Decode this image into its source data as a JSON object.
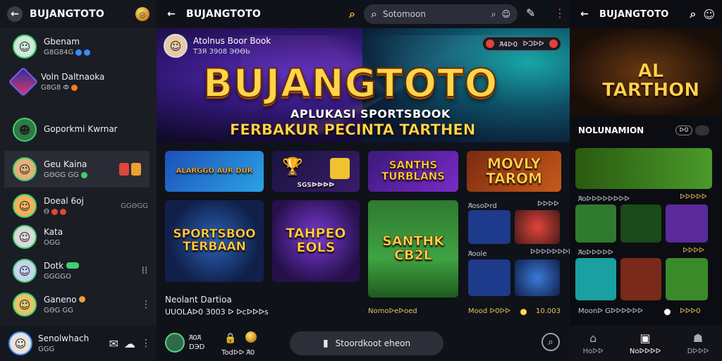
{
  "left_panel": {
    "header_title": "BUJANGTOTO",
    "chats": [
      {
        "name": "Gbenam",
        "sub": "G8G84G",
        "right": ""
      },
      {
        "name": "Voln Daltnaoka",
        "sub": "G8G8 Ф",
        "right": ""
      },
      {
        "name": "Goporkmi Kwrnar",
        "sub": "",
        "right": ""
      },
      {
        "name": "Geu Kaina",
        "sub": "GΘGG GG",
        "right": ""
      },
      {
        "name": "Doeal 6oj",
        "sub": "Ө",
        "right": "GGΘGG"
      },
      {
        "name": "Kata",
        "sub": "OGG",
        "right": ""
      },
      {
        "name": "Dotk",
        "sub": "GGGGO",
        "right": ""
      },
      {
        "name": "Ganeno",
        "sub": "GΘG GG",
        "right": ""
      },
      {
        "name": "Senolwhach",
        "sub": "GGG",
        "right": ""
      }
    ]
  },
  "banner": {
    "logo": "BUJANGTOTO",
    "tagline1": "APLUKASI SPORTSBOOK",
    "tagline2": "FERBAKUR PECINTA TARTHEN",
    "account_name": "Atolnus Boor Book",
    "account_sub": "ТЗЯ 3908 ЭӨӨЬ",
    "pill_left": "Ꞻ4ᐅ0",
    "pill_right": "ᐅƆᐅᐅ"
  },
  "middle": {
    "header_title": "BUJANGTOTO",
    "tiles": [
      {
        "label": "ALARGGO AUR DUR",
        "sub": "ᐅᐅᐅᐅ"
      },
      {
        "label": "",
        "sub": "SGSᐅᐅᐅᐅ"
      },
      {
        "label": "SPORTSBOO TERBAAN",
        "sub": ""
      },
      {
        "label": "TAHPEO EOLS",
        "sub": ""
      }
    ],
    "caption_title": "Neolant Dartioa",
    "caption_sub": "UUOLAᐅ0 3003 ᐅ ᐅcᐅᐅᐅs",
    "bottom_nav": {
      "mini_top": "Ꞻ0Ꞻ",
      "mini_bottom": "DЭD",
      "label": "Todᐅᐅ Ꞻ0"
    }
  },
  "search": {
    "placeholder": "Sotomoon",
    "button_label": "Stoordkoot eheon"
  },
  "games": {
    "tiles": [
      {
        "label": "SANTHS TURBLANS"
      },
      {
        "label": "MOVLY TAROM"
      },
      {
        "label": "SANTHK CB2L"
      }
    ],
    "small": [
      {
        "label": "Ꞻosoᐅrd",
        "value": "ᐅᐅᐅᐅ"
      },
      {
        "label": "Ꞻoole",
        "value": "ᐅᐅᐅᐅᐅᐅᐅᐅ"
      }
    ],
    "bottom_left": "Nomoᐅeᐅoed",
    "bottom_mid": "Mood ᐅ0ᐅᐅ",
    "bottom_right": "10.003"
  },
  "right_panel": {
    "header_title": "BUJANGTOTO",
    "hero": "AL TARTHON",
    "section": "NOLUNAMION",
    "badge": "ᐅ0",
    "row1_label": "Ꞻoᐅᐅᐅᐅᐅᐅᐅᐅ",
    "row1_value": "ᐅᐅᐅᐅᐅ",
    "row2_label": "Ꞻoᐅᐅᐅᐅᐅ",
    "row2_value": "ᐅᐅᐅᐅ",
    "foot_label": "Moonᐅ Gᐅᐅᐅᐅᐅᐅ",
    "foot_value": "ᐅᐅᐅ0",
    "nav": [
      {
        "label": "Hoᐅᐅ"
      },
      {
        "label": "Noᐅᐅᐅᐅ"
      },
      {
        "label": "Dᐅᐅᐅ"
      }
    ]
  }
}
